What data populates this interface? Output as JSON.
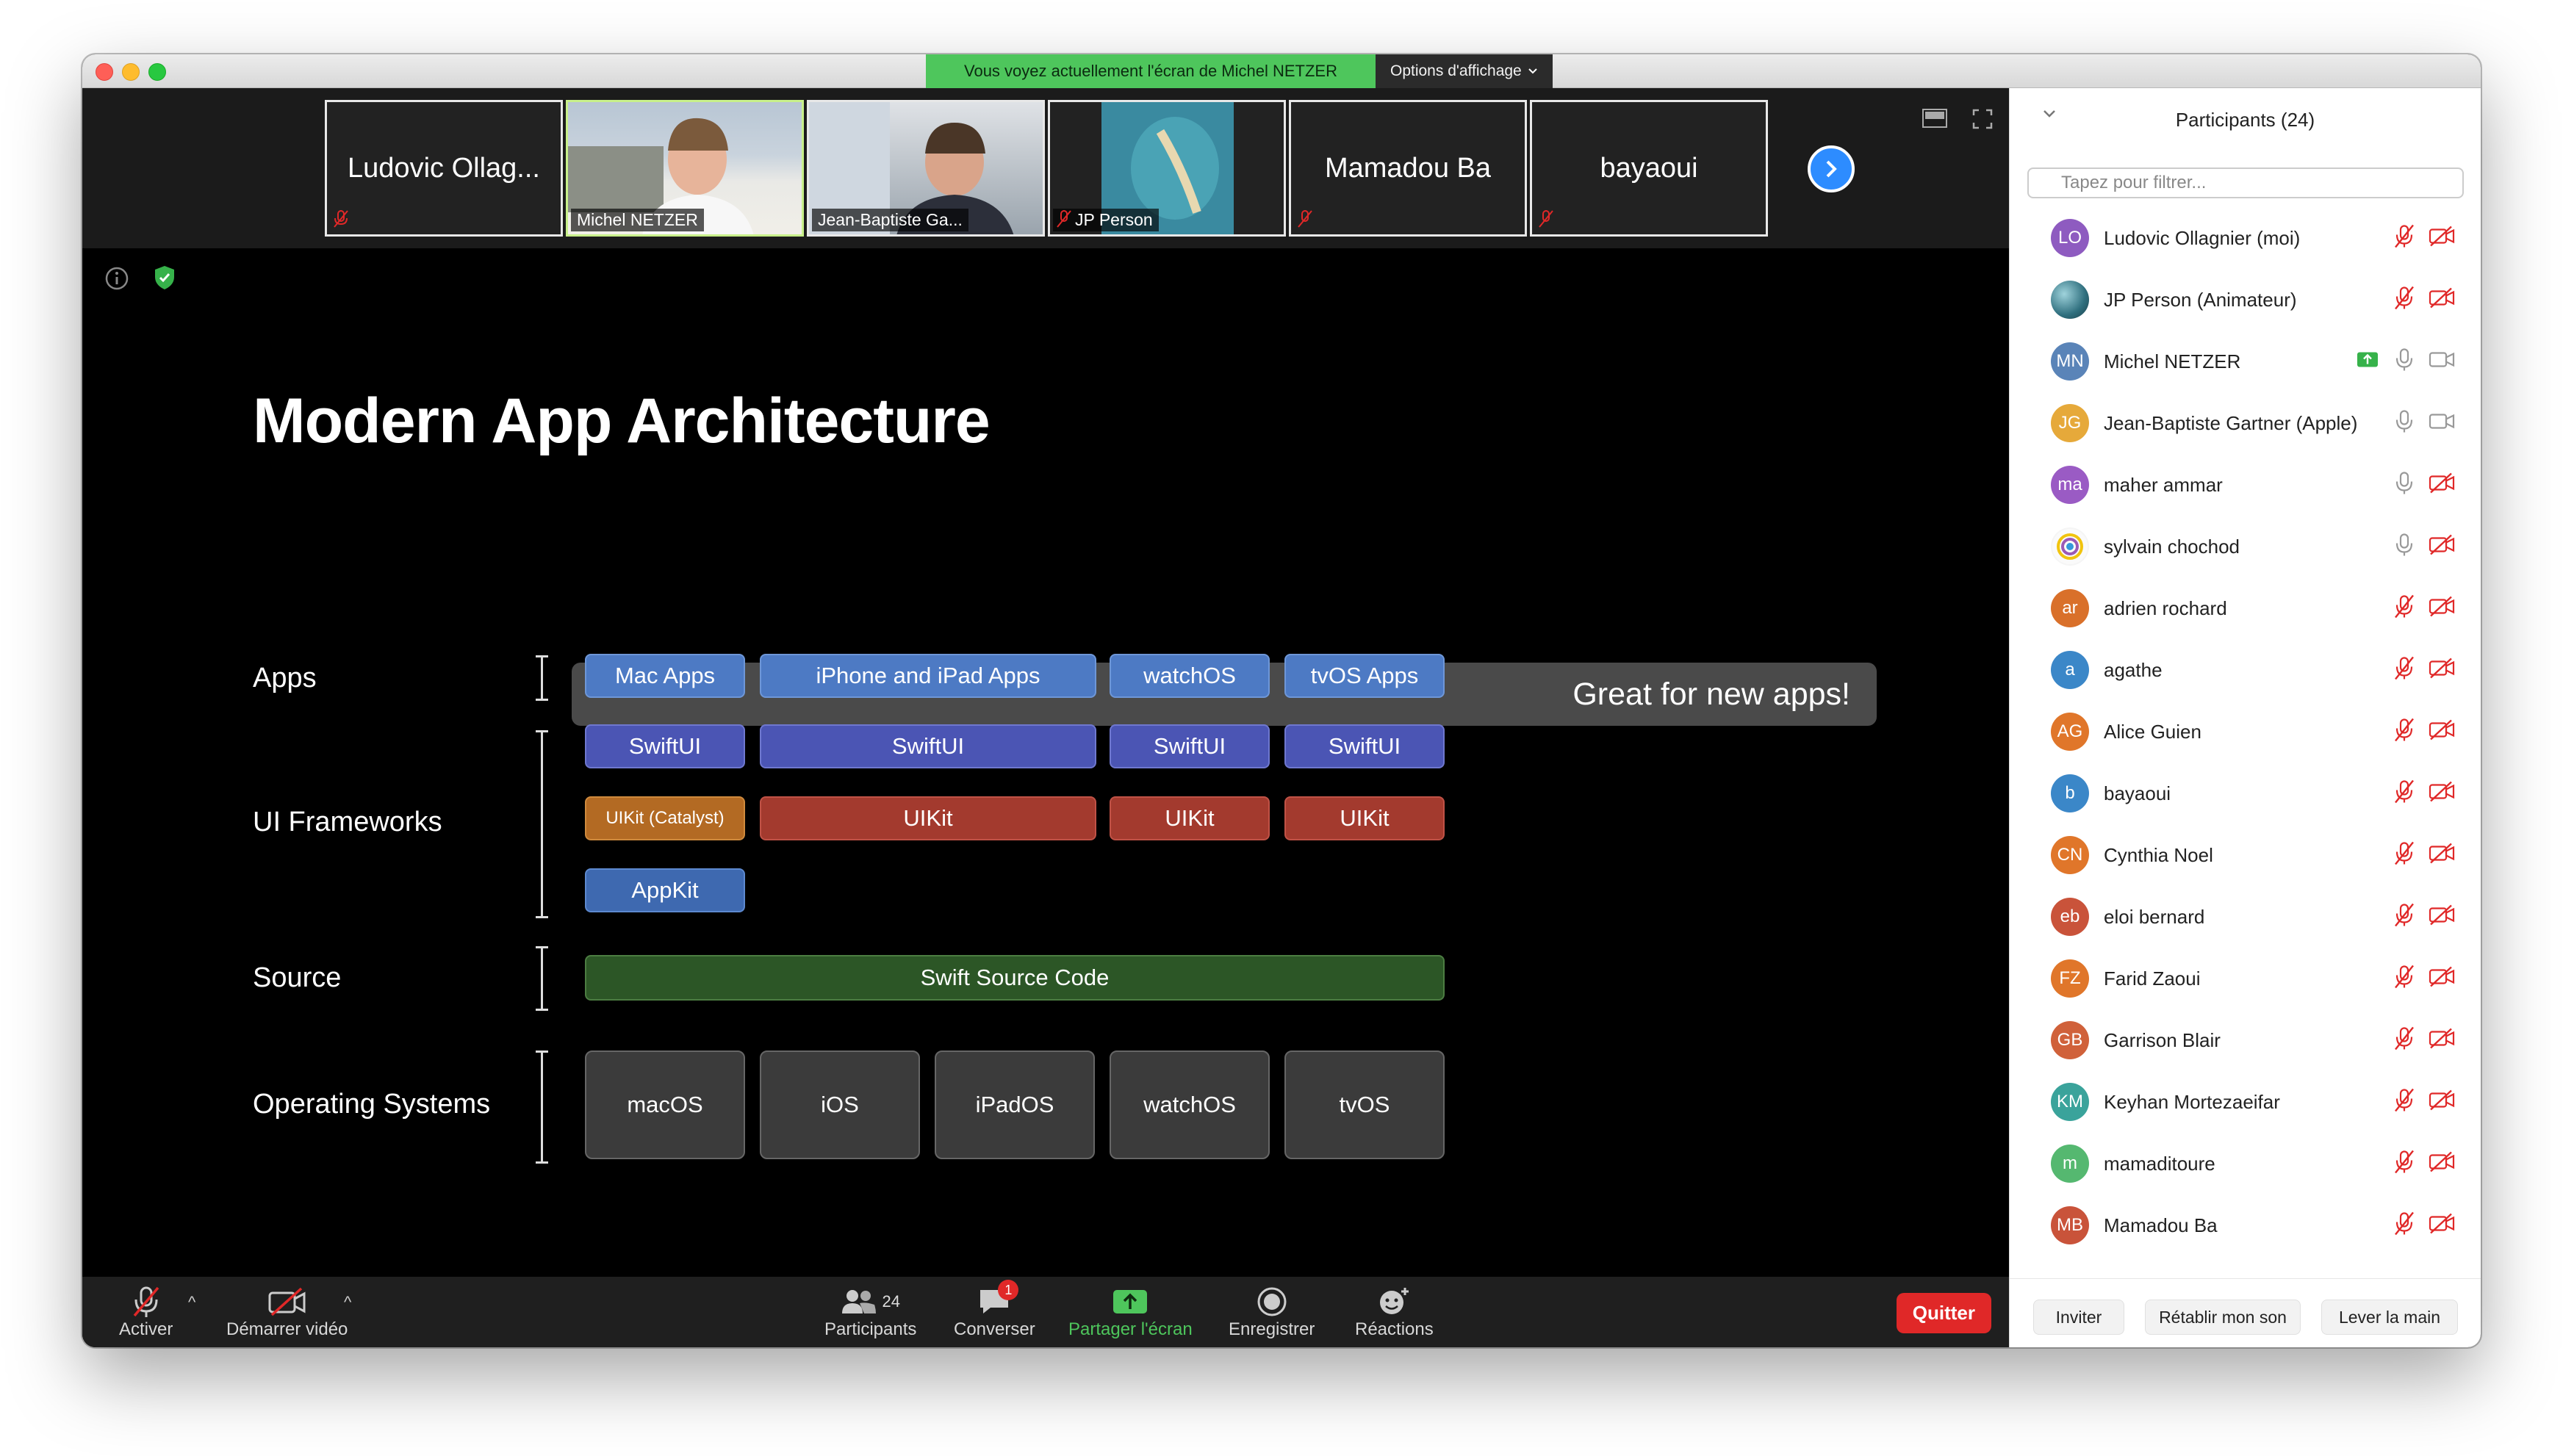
{
  "share_banner": {
    "text": "Vous voyez actuellement l'écran de Michel NETZER",
    "options_label": "Options d'affichage"
  },
  "thumbnails": [
    {
      "name": "Ludovic Ollag...",
      "type": "name",
      "muted": true
    },
    {
      "name": "Michel NETZER",
      "type": "video",
      "muted": false,
      "active": true
    },
    {
      "name": "Jean-Baptiste Ga...",
      "type": "video",
      "muted": false
    },
    {
      "name": "JP Person",
      "type": "video",
      "muted": true
    },
    {
      "name": "Mamadou Ba",
      "type": "name",
      "muted": true
    },
    {
      "name": "bayaoui",
      "type": "name",
      "muted": true
    }
  ],
  "slide": {
    "title": "Modern App Architecture",
    "rows": {
      "apps": "Apps",
      "ui": "UI Frameworks",
      "source": "Source",
      "os": "Operating Systems"
    },
    "apps": [
      "Mac Apps",
      "iPhone and iPad Apps",
      "watchOS",
      "tvOS Apps"
    ],
    "swiftui": [
      "SwiftUI",
      "SwiftUI",
      "SwiftUI",
      "SwiftUI"
    ],
    "uikit": [
      "UIKit (Catalyst)",
      "UIKit",
      "UIKit",
      "UIKit"
    ],
    "appkit": "AppKit",
    "source_code": "Swift Source Code",
    "os_list": [
      "macOS",
      "iOS",
      "iPadOS",
      "watchOS",
      "tvOS"
    ],
    "callout": "Great for new apps!"
  },
  "toolbar": {
    "mute_label": "Activer",
    "video_label": "Démarrer vidéo",
    "participants_label": "Participants",
    "participants_count": "24",
    "chat_label": "Converser",
    "chat_badge": "1",
    "share_label": "Partager l'écran",
    "record_label": "Enregistrer",
    "reactions_label": "Réactions",
    "quit_label": "Quitter"
  },
  "panel": {
    "title": "Participants (24)",
    "filter_placeholder": "Tapez pour filtrer...",
    "participants": [
      {
        "initials": "LO",
        "name": "Ludovic Ollagnier (moi)",
        "color": "#8e5bc0",
        "mic": "off",
        "cam": "off"
      },
      {
        "initials": "",
        "name": "JP Person (Animateur)",
        "color": "#2f6f7e",
        "mic": "off",
        "cam": "off"
      },
      {
        "initials": "MN",
        "name": "Michel NETZER",
        "color": "#5a84b8",
        "mic": "on",
        "cam": "on",
        "sharing": true
      },
      {
        "initials": "JG",
        "name": "Jean-Baptiste Gartner (Apple)",
        "color": "#e6a93a",
        "mic": "on",
        "cam": "on"
      },
      {
        "initials": "ma",
        "name": "maher ammar",
        "color": "#9a5bc4",
        "mic": "on",
        "cam": "off"
      },
      {
        "initials": "",
        "name": "sylvain chochod",
        "color": "#f5f5f5",
        "mic": "on",
        "cam": "off"
      },
      {
        "initials": "ar",
        "name": "adrien rochard",
        "color": "#d9702a",
        "mic": "off",
        "cam": "off"
      },
      {
        "initials": "a",
        "name": "agathe",
        "color": "#3b87c8",
        "mic": "off",
        "cam": "off"
      },
      {
        "initials": "AG",
        "name": "Alice Guien",
        "color": "#e0762a",
        "mic": "off",
        "cam": "off"
      },
      {
        "initials": "b",
        "name": "bayaoui",
        "color": "#3b87c8",
        "mic": "off",
        "cam": "off"
      },
      {
        "initials": "CN",
        "name": "Cynthia Noel",
        "color": "#e0762a",
        "mic": "off",
        "cam": "off"
      },
      {
        "initials": "eb",
        "name": "eloi bernard",
        "color": "#c9533a",
        "mic": "off",
        "cam": "off"
      },
      {
        "initials": "FZ",
        "name": "Farid Zaoui",
        "color": "#e0762a",
        "mic": "off",
        "cam": "off"
      },
      {
        "initials": "GB",
        "name": "Garrison Blair",
        "color": "#d0613a",
        "mic": "off",
        "cam": "off"
      },
      {
        "initials": "KM",
        "name": "Keyhan Mortezaeifar",
        "color": "#3aa39b",
        "mic": "off",
        "cam": "off"
      },
      {
        "initials": "m",
        "name": "mamaditoure",
        "color": "#55b870",
        "mic": "off",
        "cam": "off"
      },
      {
        "initials": "MB",
        "name": "Mamadou Ba",
        "color": "#c9533a",
        "mic": "off",
        "cam": "off"
      }
    ],
    "footer": {
      "invite": "Inviter",
      "unmute": "Rétablir mon son",
      "raise_hand": "Lever la main"
    }
  },
  "colors": {
    "accent_blue": "#2d8cff",
    "share_green": "#4ec65c",
    "mute_red": "#e02828"
  }
}
